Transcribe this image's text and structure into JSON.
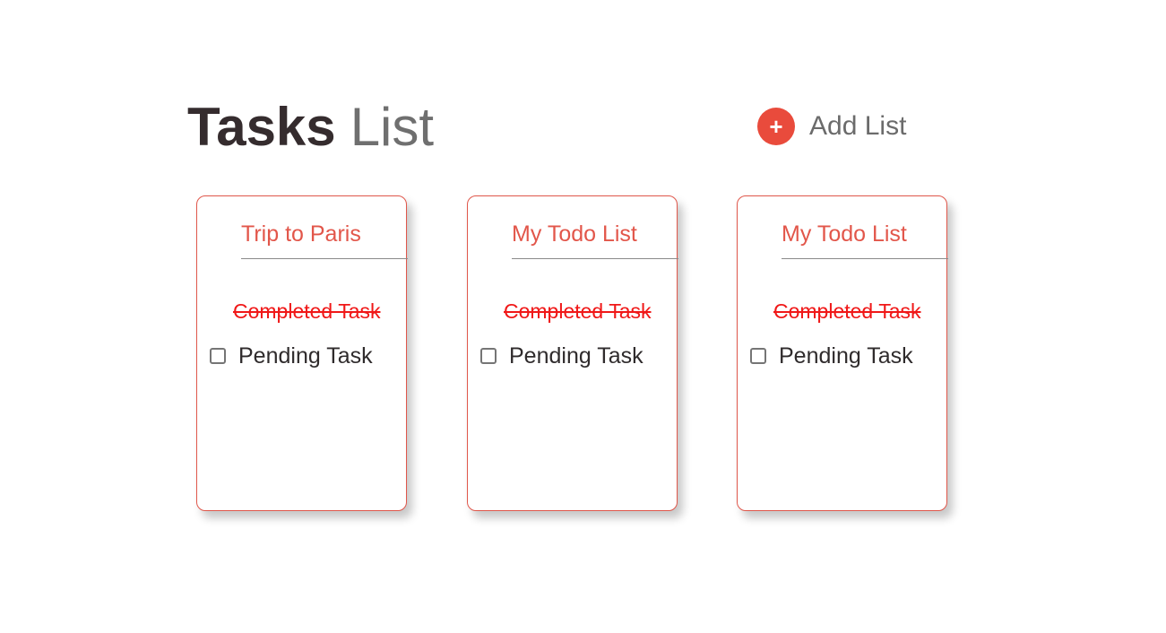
{
  "header": {
    "title_bold": "Tasks",
    "title_light": "List"
  },
  "add_list": {
    "icon_glyph": "+",
    "icon": "plus-icon",
    "label": "Add List"
  },
  "colors": {
    "accent": "#e94b3c",
    "completed_text": "#f01818",
    "title_dark": "#352c2e"
  },
  "lists": [
    {
      "title": "Trip to Paris",
      "completed_tasks": [
        "Completed Task"
      ],
      "pending_tasks": [
        "Pending Task"
      ]
    },
    {
      "title": "My Todo List",
      "completed_tasks": [
        "Completed Task"
      ],
      "pending_tasks": [
        "Pending Task"
      ]
    },
    {
      "title": "My Todo List",
      "completed_tasks": [
        "Completed Task"
      ],
      "pending_tasks": [
        "Pending Task"
      ]
    }
  ]
}
